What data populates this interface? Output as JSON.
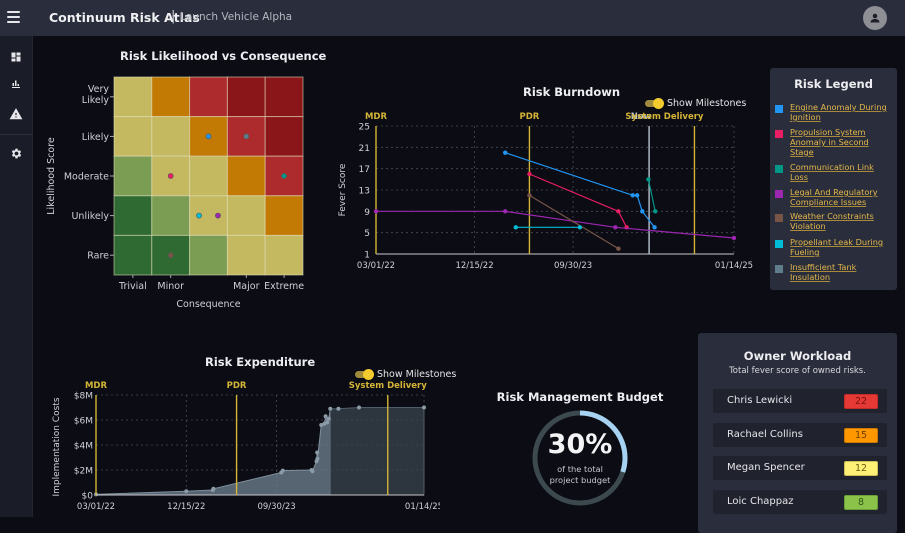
{
  "header": {
    "app_title": "Continuum Risk Atlas",
    "separator": "|",
    "project_name": "Launch Vehicle Alpha"
  },
  "sidebar": {
    "items": [
      {
        "name": "dashboard",
        "icon": "dashboard-icon"
      },
      {
        "name": "charts",
        "icon": "bar-chart-icon"
      },
      {
        "name": "risks",
        "icon": "warning-icon"
      },
      {
        "name": "settings",
        "icon": "gear-icon"
      }
    ]
  },
  "risks": [
    {
      "name": "Engine Anomaly During Ignition",
      "color": "#2196f3"
    },
    {
      "name": "Propulsion System Anomaly in Second Stage",
      "color": "#e91e63"
    },
    {
      "name": "Communication Link Loss",
      "color": "#009688"
    },
    {
      "name": "Legal And Regulatory Compliance Issues",
      "color": "#9c27b0"
    },
    {
      "name": "Weather Constraints Violation",
      "color": "#795548"
    },
    {
      "name": "Propellant Leak During Fueling",
      "color": "#00bcd4"
    },
    {
      "name": "Insufficient Tank Insulation",
      "color": "#607d8b"
    }
  ],
  "legend": {
    "title": "Risk Legend"
  },
  "milestones_toggle": {
    "label": "Show Milestones",
    "on": true
  },
  "chart_data": [
    {
      "type": "heatmap",
      "title": "Risk Likelihood vs Consequence",
      "xlabel": "Consequence",
      "ylabel": "Likelihood Score",
      "x_ticks": [
        "Trivial",
        "Minor",
        "",
        "Major",
        "Extreme"
      ],
      "y_ticks": [
        "Rare",
        "Unlikely",
        "Moderate",
        "Likely",
        "Very Likely"
      ],
      "grid_rows_top_to_bottom": [
        [
          "#c4b961",
          "#c27a05",
          "#ad2b2d",
          "#8b161a",
          "#8b161a"
        ],
        [
          "#c4b961",
          "#c4b961",
          "#c27a05",
          "#ad2b2d",
          "#8b161a"
        ],
        [
          "#7a9c53",
          "#c4b961",
          "#c4b961",
          "#c27a05",
          "#ad2b2d"
        ],
        [
          "#2e6a31",
          "#7a9c53",
          "#c4b961",
          "#c4b961",
          "#c27a05"
        ],
        [
          "#2e6a31",
          "#2e6a31",
          "#7a9c53",
          "#c4b961",
          "#c4b961"
        ]
      ],
      "points": [
        {
          "risk": 0,
          "consequence": 3,
          "likelihood": 4
        },
        {
          "risk": 6,
          "consequence": 4,
          "likelihood": 4
        },
        {
          "risk": 1,
          "consequence": 2,
          "likelihood": 3
        },
        {
          "risk": 2,
          "consequence": 5,
          "likelihood": 3
        },
        {
          "risk": 5,
          "consequence": 2.75,
          "likelihood": 2
        },
        {
          "risk": 3,
          "consequence": 3.25,
          "likelihood": 2
        },
        {
          "risk": 4,
          "consequence": 2,
          "likelihood": 1
        }
      ]
    },
    {
      "type": "line",
      "title": "Risk Burndown",
      "xlabel": "",
      "ylabel": "Fever Score",
      "x_range": [
        "2022-03-01",
        "2025-01-14"
      ],
      "x_ticks": [
        "03/01/22",
        "12/15/22",
        "09/30/23",
        "01/14/25"
      ],
      "x_tick_dates": [
        "2022-03-01",
        "2022-12-15",
        "2023-09-30",
        "2025-01-14"
      ],
      "ylim": [
        1,
        25
      ],
      "y_ticks": [
        1,
        5,
        9,
        13,
        17,
        21,
        25
      ],
      "grid": true,
      "milestones": [
        {
          "label": "MDR",
          "date": "2022-03-01",
          "color": "#d4b537"
        },
        {
          "label": "PDR",
          "date": "2023-05-25",
          "color": "#d4b537"
        },
        {
          "label": "Now",
          "date": "2024-05-10",
          "color": "#b7c4d0"
        },
        {
          "label": "System Delivery",
          "date": "2024-09-20",
          "color": "#d4b537"
        }
      ],
      "series": [
        {
          "risk": 0,
          "points": [
            [
              "2023-03-15",
              20
            ],
            [
              "2024-03-23",
              12
            ],
            [
              "2024-04-05",
              12
            ],
            [
              "2024-04-20",
              9
            ],
            [
              "2024-05-26",
              6
            ]
          ]
        },
        {
          "risk": 1,
          "points": [
            [
              "2023-05-25",
              16
            ],
            [
              "2024-02-10",
              9
            ],
            [
              "2024-03-05",
              6
            ]
          ]
        },
        {
          "risk": 2,
          "points": [
            [
              "2024-05-08",
              15
            ],
            [
              "2024-05-28",
              9
            ]
          ]
        },
        {
          "risk": 3,
          "points": [
            [
              "2022-03-01",
              9
            ],
            [
              "2023-03-15",
              9
            ],
            [
              "2024-02-01",
              6
            ],
            [
              "2025-01-14",
              4
            ]
          ]
        },
        {
          "risk": 4,
          "points": [
            [
              "2023-05-25",
              12
            ],
            [
              "2024-02-10",
              2
            ]
          ]
        },
        {
          "risk": 5,
          "points": [
            [
              "2023-04-15",
              6
            ],
            [
              "2023-10-20",
              6
            ]
          ]
        }
      ]
    },
    {
      "type": "area",
      "title": "Risk Expenditure",
      "xlabel": "",
      "ylabel": "Implementation Costs",
      "x_range": [
        "2022-03-01",
        "2025-01-14"
      ],
      "x_ticks": [
        "03/01/22",
        "12/15/22",
        "09/30/23",
        "01/14/25"
      ],
      "x_tick_dates": [
        "2022-03-01",
        "2022-12-15",
        "2023-09-30",
        "2025-01-14"
      ],
      "ylim": [
        0,
        8
      ],
      "y_ticks": [
        "$0",
        "$2M",
        "$4M",
        "$6M",
        "$8M"
      ],
      "y_tick_values": [
        0,
        2,
        4,
        6,
        8
      ],
      "grid": true,
      "milestones": [
        {
          "label": "MDR",
          "date": "2022-03-01",
          "color": "#d4b537"
        },
        {
          "label": "PDR",
          "date": "2023-05-25",
          "color": "#d4b537"
        },
        {
          "label": "System Delivery",
          "date": "2024-09-20",
          "color": "#d4b537"
        }
      ],
      "now_date": "2024-03-20",
      "points": [
        [
          "2022-03-01",
          0.05
        ],
        [
          "2022-12-15",
          0.3
        ],
        [
          "2023-03-10",
          0.4
        ],
        [
          "2023-03-12",
          0.5
        ],
        [
          "2023-10-15",
          1.8
        ],
        [
          "2023-10-20",
          1.95
        ],
        [
          "2024-01-20",
          2.0
        ],
        [
          "2024-01-23",
          1.9
        ],
        [
          "2024-02-05",
          2.7
        ],
        [
          "2024-02-08",
          2.9
        ],
        [
          "2024-02-07",
          3.4
        ],
        [
          "2024-02-20",
          5.6
        ],
        [
          "2024-03-01",
          5.7
        ],
        [
          "2024-03-10",
          5.8
        ],
        [
          "2024-03-15",
          6.1
        ],
        [
          "2024-03-05",
          6.3
        ],
        [
          "2024-03-20",
          6.9
        ],
        [
          "2024-04-15",
          6.9
        ],
        [
          "2024-06-20",
          7.0
        ],
        [
          "2025-01-14",
          7.0
        ]
      ]
    },
    {
      "type": "pie",
      "title": "Risk Management Budget",
      "value_percent": 30,
      "label": "30%",
      "sublabel": "of the total project budget"
    }
  ],
  "budget": {
    "title": "Risk Management Budget",
    "percent_label": "30%",
    "sub_line1": "of the total",
    "sub_line2": "project budget",
    "percent": 30
  },
  "owner_workload": {
    "title": "Owner Workload",
    "subtitle": "Total fever score of owned risks.",
    "owners": [
      {
        "name": "Chris Lewicki",
        "score": "22",
        "bg": "#e53935",
        "fg": "#7a1010"
      },
      {
        "name": "Rachael Collins",
        "score": "15",
        "bg": "#ff9800",
        "fg": "#6a3c00"
      },
      {
        "name": "Megan Spencer",
        "score": "12",
        "bg": "#fff176",
        "fg": "#6a5d10"
      },
      {
        "name": "Loic Chappaz",
        "score": "8",
        "bg": "#8bc34a",
        "fg": "#2f5417"
      }
    ]
  }
}
